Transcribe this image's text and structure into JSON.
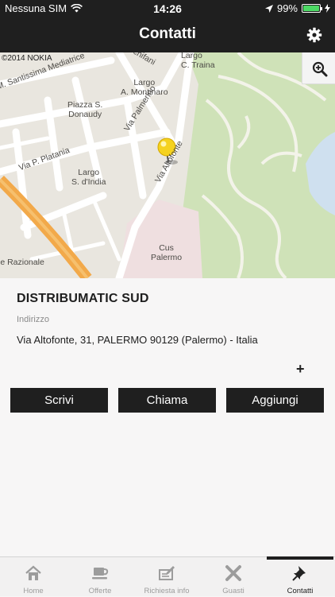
{
  "status_bar": {
    "carrier": "Nessuna SIM",
    "time": "14:26",
    "battery": "99%",
    "battery_level": 0.99
  },
  "nav": {
    "title": "Contatti",
    "settings_icon": "gear-icon"
  },
  "map": {
    "copyright": "©2014 NOKIA",
    "zoom_icon": "zoom-in-icon",
    "labels": {
      "santissima": "M. Santissima Mediatrice",
      "schifani": "Schifani",
      "largo_ctraina": "Largo\nC. Traina",
      "largo_montinaro": "Largo\nA. Montinaro",
      "piazza_donaudy": "Piazza S.\nDonaudy",
      "via_palmerino": "Via Palmerino",
      "via_platania": "Via P. Platania",
      "via_altofonte": "Via Altofonte",
      "largo_dindia": "Largo\nS. d'India",
      "cus_palermo": "Cus\nPalermo",
      "razionale": "le Razionale"
    }
  },
  "contact": {
    "company": "DISTRIBUMATIC SUD",
    "address_label": "Indirizzo",
    "address": "Via Altofonte, 31, PALERMO 90129 (Palermo) - Italia",
    "add_symbol": "+"
  },
  "actions": {
    "write": "Scrivi",
    "call": "Chiama",
    "add": "Aggiungi"
  },
  "tabs": [
    {
      "label": "Home",
      "icon": "home-icon"
    },
    {
      "label": "Offerte",
      "icon": "coffee-cup-icon"
    },
    {
      "label": "Richiesta info",
      "icon": "edit-form-icon"
    },
    {
      "label": "Guasti",
      "icon": "wrench-cross-icon"
    },
    {
      "label": "Contatti",
      "icon": "pin-icon",
      "active": true
    }
  ],
  "colors": {
    "bar_background": "#1f1f1f",
    "accent_green_battery": "#4cd964",
    "map_park": "#cfe2b8",
    "map_road_major": "#f2a94a",
    "pin_yellow": "#f5d21f"
  }
}
